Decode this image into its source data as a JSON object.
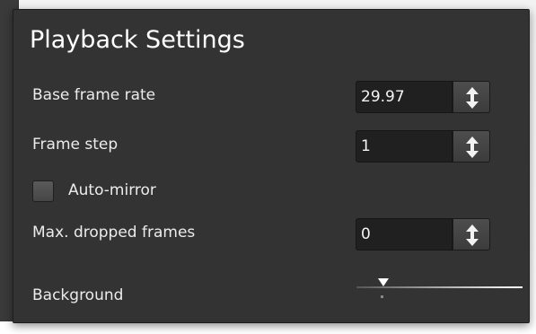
{
  "panel": {
    "title": "Playback Settings"
  },
  "settings": {
    "base_frame_rate": {
      "label": "Base frame rate",
      "value": "29.97",
      "spin_icon": "up-down-arrow-icon"
    },
    "frame_step": {
      "label": "Frame step",
      "value": "1",
      "spin_icon": "up-down-arrow-icon"
    },
    "auto_mirror": {
      "label": "Auto-mirror",
      "checked": false
    },
    "max_dropped_frames": {
      "label": "Max. dropped frames",
      "value": "0",
      "spin_icon": "up-down-arrow-icon"
    },
    "background": {
      "label": "Background",
      "level": 0.16
    }
  },
  "colors": {
    "panel_bg": "#333333",
    "field_bg": "#202020",
    "text": "#ececec"
  }
}
